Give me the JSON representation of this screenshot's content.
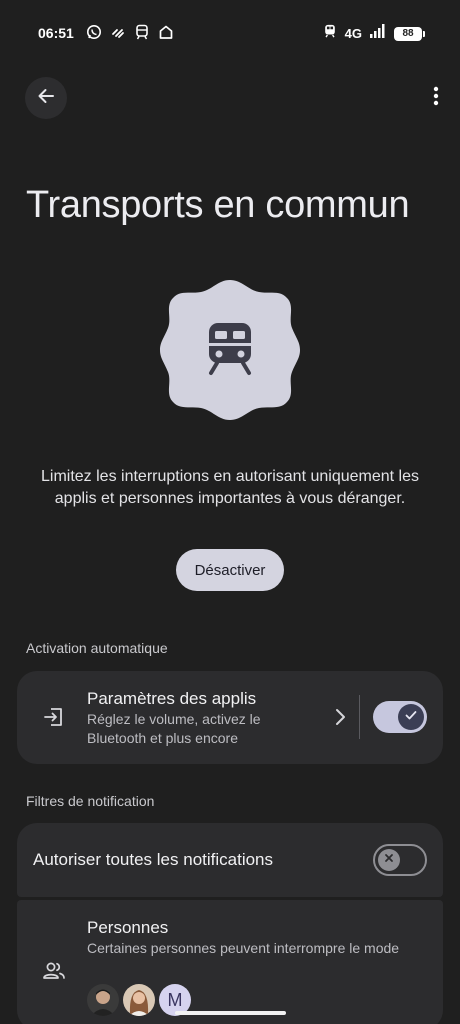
{
  "status_bar": {
    "time": "06:51",
    "network": "4G",
    "battery": "88",
    "left_icons": [
      "whatsapp-icon",
      "link-icon",
      "train-icon",
      "home-icon"
    ],
    "right_icons": [
      "train-icon",
      "signal-icon",
      "battery-icon"
    ]
  },
  "header": {
    "back_icon": "arrow-back-icon",
    "menu_icon": "more-vert-icon"
  },
  "page": {
    "title": "Transports en commun",
    "hero_icon": "train-icon",
    "description": "Limitez les interruptions en autorisant uniquement les applis et personnes importantes à vous déranger.",
    "deactivate_label": "Désactiver"
  },
  "auto_activation": {
    "section_label": "Activation automatique",
    "app_settings": {
      "title": "Paramètres des applis",
      "subtitle": "Réglez le volume, activez le Bluetooth et plus encore",
      "icon": "login-icon",
      "enabled": true
    }
  },
  "notification_filters": {
    "section_label": "Filtres de notification",
    "allow_all": {
      "title": "Autoriser toutes les notifications",
      "enabled": false
    },
    "people": {
      "title": "Personnes",
      "subtitle": "Certaines personnes peuvent interrompre le mode",
      "icon": "people-icon",
      "avatars": [
        {
          "type": "photo"
        },
        {
          "type": "photo"
        },
        {
          "type": "letter",
          "letter": "M"
        }
      ]
    }
  },
  "colors": {
    "background": "#1f1f1f",
    "card": "#2c2c2e",
    "accent": "#c6c7de",
    "button": "#d4d4e0"
  }
}
